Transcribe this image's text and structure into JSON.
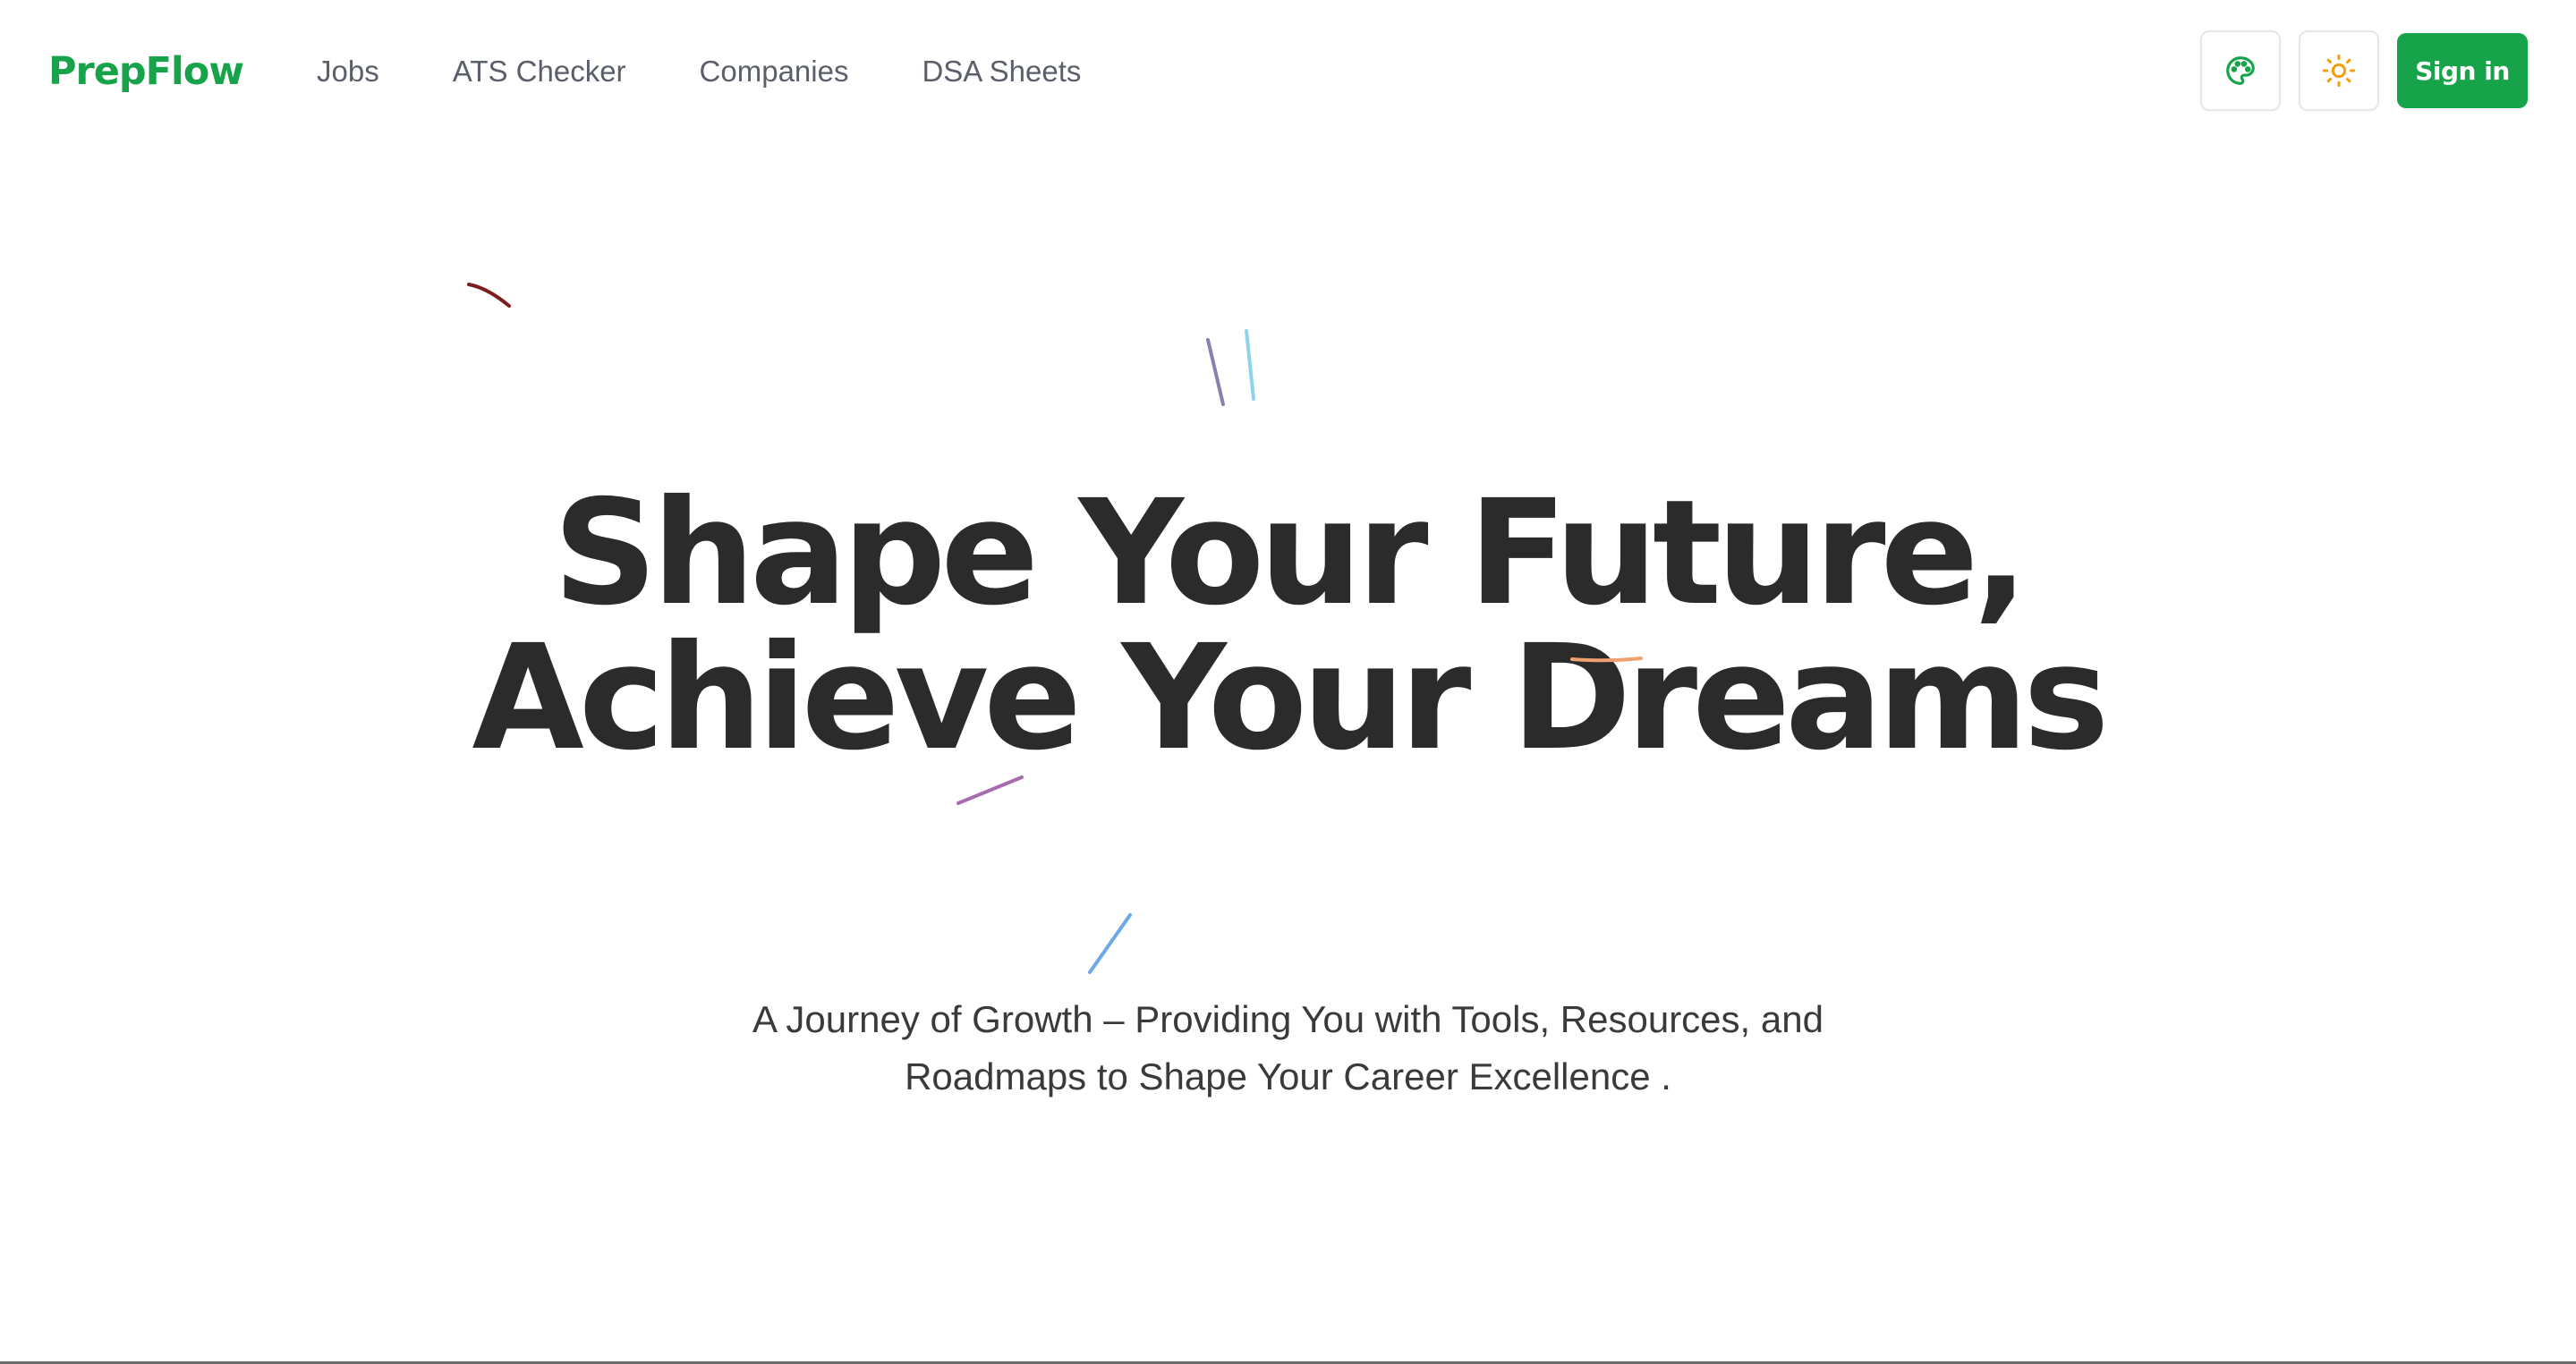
{
  "brand": {
    "name": "PrepFlow",
    "accent_color": "#16a34a"
  },
  "nav": {
    "links": [
      {
        "label": "Jobs"
      },
      {
        "label": "ATS Checker"
      },
      {
        "label": "Companies"
      },
      {
        "label": "DSA Sheets"
      }
    ],
    "theme_palette_icon": "palette-icon",
    "theme_toggle_icon": "sun-icon",
    "signin_label": "Sign in"
  },
  "hero": {
    "title_line1": "Shape Your Future,",
    "title_line2": "Achieve Your Dreams",
    "subtitle_line1": "A Journey of Growth – Providing You with Tools, Resources, and",
    "subtitle_line2": "Roadmaps to Shape Your Career Excellence ."
  },
  "colors": {
    "title_text": "#2b2b2b",
    "nav_text": "#5b5f6a",
    "spark_dark_red": "#7f1d1d",
    "spark_purple": "#8b7fb0",
    "spark_light_blue": "#8fd3ea",
    "spark_orange": "#f0a070",
    "spark_magenta": "#a86bb0",
    "spark_blue": "#6aa8e6"
  }
}
